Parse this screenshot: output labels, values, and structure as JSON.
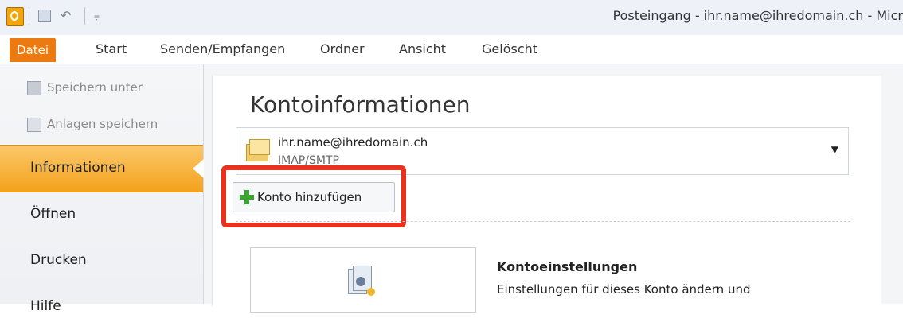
{
  "window": {
    "title": "Posteingang - ihr.name@ihredomain.ch - Micr"
  },
  "tabs": [
    {
      "label": "Datei"
    },
    {
      "label": "Start"
    },
    {
      "label": "Senden/Empfangen"
    },
    {
      "label": "Ordner"
    },
    {
      "label": "Ansicht"
    },
    {
      "label": "Gelöscht"
    }
  ],
  "nav": {
    "commands": [
      {
        "label": "Speichern unter",
        "icon": "save-as-icon"
      },
      {
        "label": "Anlagen speichern",
        "icon": "save-attachments-icon"
      }
    ],
    "items": [
      {
        "label": "Informationen",
        "active": true
      },
      {
        "label": "Öffnen"
      },
      {
        "label": "Drucken"
      },
      {
        "label": "Hilfe"
      }
    ]
  },
  "main": {
    "title": "Kontoinformationen",
    "account": {
      "email": "ihr.name@ihredomain.ch",
      "type": "IMAP/SMTP"
    },
    "add_button_label": "Konto hinzufügen",
    "settings": {
      "title": "Kontoeinstellungen",
      "description": "Einstellungen für dieses Konto ändern und"
    }
  },
  "colors": {
    "file_tab": "#ec7a10",
    "active_nav": "#f3a21c",
    "highlight": "#e8321e"
  }
}
